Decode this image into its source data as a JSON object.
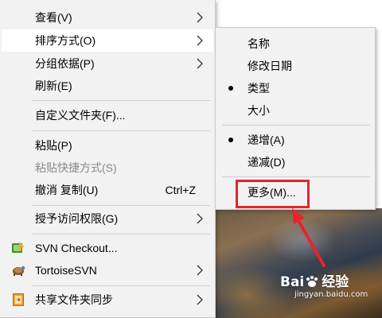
{
  "main_menu": {
    "items": [
      {
        "label": "查看(V)"
      },
      {
        "label": "排序方式(O)"
      },
      {
        "label": "分组依据(P)"
      },
      {
        "label": "刷新(E)"
      },
      {
        "label": "自定义文件夹(F)..."
      },
      {
        "label": "粘贴(P)"
      },
      {
        "label": "粘贴快捷方式(S)"
      },
      {
        "label": "撤消 复制(U)",
        "accel": "Ctrl+Z"
      },
      {
        "label": "授予访问权限(G)"
      },
      {
        "label": "SVN Checkout..."
      },
      {
        "label": "TortoiseSVN"
      },
      {
        "label": "共享文件夹同步"
      }
    ]
  },
  "sort_submenu": {
    "items": [
      {
        "label": "名称"
      },
      {
        "label": "修改日期"
      },
      {
        "label": "类型"
      },
      {
        "label": "大小"
      },
      {
        "label": "递增(A)"
      },
      {
        "label": "递减(D)"
      },
      {
        "label": "更多(M)..."
      }
    ]
  },
  "watermark": {
    "brand_a": "Bai",
    "brand_b": "经验",
    "site": "jingyan.baidu.com"
  },
  "colors": {
    "menu_bg": "#f2f2f2",
    "highlight": "#ffffff",
    "annotation": "#e8232d"
  }
}
